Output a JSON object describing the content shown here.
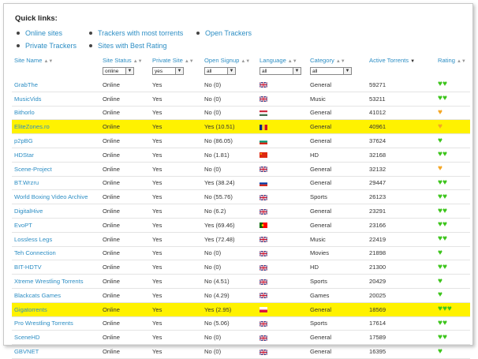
{
  "quick_links": {
    "title": "Quick links:",
    "links": [
      "Online sites",
      "Trackers with most torrents",
      "Open Trackers",
      "Private Trackers",
      "Sites with Best Rating"
    ]
  },
  "columns": [
    "Site Name",
    "Site Status",
    "Private Site",
    "Open Signup",
    "Language",
    "Category",
    "Active Torrents",
    "Rating"
  ],
  "filters": {
    "status": "online",
    "private": "yes",
    "signup": "all",
    "language": "all",
    "category": "all"
  },
  "rows": [
    {
      "name": "GrabThe",
      "status": "Online",
      "private": "Yes",
      "signup": "No (0)",
      "flag": "uk",
      "category": "General",
      "torrents": "59271",
      "rating": 2,
      "rc": "green",
      "hl": false
    },
    {
      "name": "MusicVids",
      "status": "Online",
      "private": "Yes",
      "signup": "No (0)",
      "flag": "uk",
      "category": "Music",
      "torrents": "53211",
      "rating": 2,
      "rc": "green",
      "hl": false
    },
    {
      "name": "Bithorlo",
      "status": "Online",
      "private": "Yes",
      "signup": "No (0)",
      "flag": "hu",
      "category": "General",
      "torrents": "41012",
      "rating": 1,
      "rc": "orange",
      "hl": false
    },
    {
      "name": "EliteZones.ro",
      "status": "Online",
      "private": "Yes",
      "signup": "Yes (10.51)",
      "flag": "ro",
      "category": "General",
      "torrents": "40961",
      "rating": 1,
      "rc": "orange",
      "hl": true
    },
    {
      "name": "p2pBG",
      "status": "Online",
      "private": "Yes",
      "signup": "No (86.05)",
      "flag": "bg",
      "category": "General",
      "torrents": "37624",
      "rating": 1,
      "rc": "green",
      "hl": false
    },
    {
      "name": "HDStar",
      "status": "Online",
      "private": "Yes",
      "signup": "No (1.81)",
      "flag": "cn",
      "category": "HD",
      "torrents": "32168",
      "rating": 2,
      "rc": "green",
      "hl": false
    },
    {
      "name": "Scene-Project",
      "status": "Online",
      "private": "Yes",
      "signup": "No (0)",
      "flag": "uk",
      "category": "General",
      "torrents": "32132",
      "rating": 1,
      "rc": "orange",
      "hl": false
    },
    {
      "name": "BT.Wrzru",
      "status": "Online",
      "private": "Yes",
      "signup": "Yes (38.24)",
      "flag": "ru",
      "category": "General",
      "torrents": "29447",
      "rating": 2,
      "rc": "green",
      "hl": false
    },
    {
      "name": "World Boxing Video Archive",
      "status": "Online",
      "private": "Yes",
      "signup": "No (55.76)",
      "flag": "uk",
      "category": "Sports",
      "torrents": "26123",
      "rating": 2,
      "rc": "green",
      "hl": false
    },
    {
      "name": "DigitalHive",
      "status": "Online",
      "private": "Yes",
      "signup": "No (6.2)",
      "flag": "uk",
      "category": "General",
      "torrents": "23291",
      "rating": 2,
      "rc": "green",
      "hl": false
    },
    {
      "name": "EvoPT",
      "status": "Online",
      "private": "Yes",
      "signup": "Yes (69.46)",
      "flag": "pt",
      "category": "General",
      "torrents": "23166",
      "rating": 2,
      "rc": "green",
      "hl": false
    },
    {
      "name": "Lossless Legs",
      "status": "Online",
      "private": "Yes",
      "signup": "Yes (72.48)",
      "flag": "uk",
      "category": "Music",
      "torrents": "22419",
      "rating": 2,
      "rc": "green",
      "hl": false
    },
    {
      "name": "Teh Connection",
      "status": "Online",
      "private": "Yes",
      "signup": "No (0)",
      "flag": "uk",
      "category": "Movies",
      "torrents": "21898",
      "rating": 1,
      "rc": "green",
      "hl": false
    },
    {
      "name": "BIT-HDTV",
      "status": "Online",
      "private": "Yes",
      "signup": "No (0)",
      "flag": "uk",
      "category": "HD",
      "torrents": "21300",
      "rating": 2,
      "rc": "green",
      "hl": false
    },
    {
      "name": "Xtreme Wrestling Torrents",
      "status": "Online",
      "private": "Yes",
      "signup": "No (4.51)",
      "flag": "uk",
      "category": "Sports",
      "torrents": "20429",
      "rating": 1,
      "rc": "green",
      "hl": false
    },
    {
      "name": "Blackcats Games",
      "status": "Online",
      "private": "Yes",
      "signup": "No (4.29)",
      "flag": "uk",
      "category": "Games",
      "torrents": "20025",
      "rating": 1,
      "rc": "green",
      "hl": false
    },
    {
      "name": "Gigatorrents",
      "status": "Online",
      "private": "Yes",
      "signup": "Yes (2.95)",
      "flag": "pl",
      "category": "General",
      "torrents": "18569",
      "rating": 3,
      "rc": "green",
      "hl": true
    },
    {
      "name": "Pro Wrestling Torrents",
      "status": "Online",
      "private": "Yes",
      "signup": "No (5.06)",
      "flag": "uk",
      "category": "Sports",
      "torrents": "17614",
      "rating": 2,
      "rc": "green",
      "hl": false
    },
    {
      "name": "SceneHD",
      "status": "Online",
      "private": "Yes",
      "signup": "No (0)",
      "flag": "uk",
      "category": "General",
      "torrents": "17589",
      "rating": 2,
      "rc": "green",
      "hl": false
    },
    {
      "name": "GBVNET",
      "status": "Online",
      "private": "Yes",
      "signup": "No (0)",
      "flag": "uk",
      "category": "General",
      "torrents": "16395",
      "rating": 1,
      "rc": "green",
      "hl": false
    }
  ],
  "colors": {
    "link": "#2d8ec4",
    "highlight": "#fff200",
    "heart_green": "#3bc41a",
    "heart_orange": "#f5a623"
  }
}
